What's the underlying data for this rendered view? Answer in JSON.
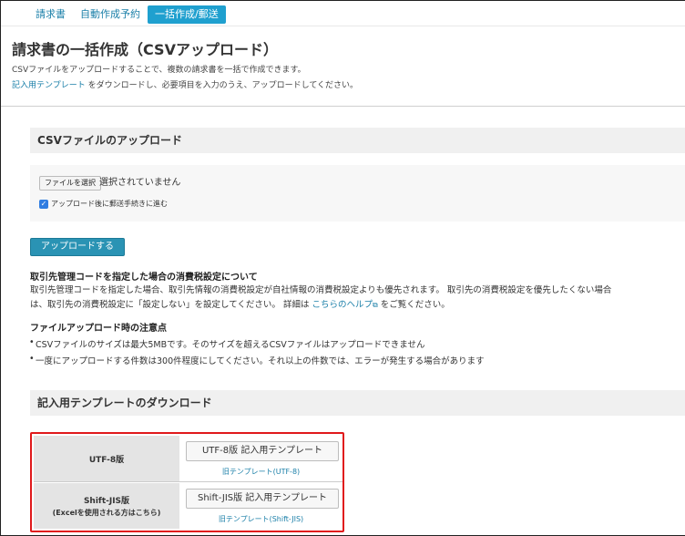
{
  "tabs": [
    {
      "label": "請求書",
      "active": false
    },
    {
      "label": "自動作成予約",
      "active": false
    },
    {
      "label": "一括作成/郵送",
      "active": true
    }
  ],
  "page_title": "請求書の一括作成（CSVアップロード）",
  "intro": {
    "line1": "CSVファイルをアップロードすることで、複数の請求書を一括で作成できます。",
    "template_link": "記入用テンプレート",
    "line2_rest": " をダウンロードし、必要項目を入力のうえ、アップロードしてください。"
  },
  "upload_section": {
    "title": "CSVファイルのアップロード",
    "file_button": "ファイルを選択",
    "file_status": "選択されていません",
    "checkbox_label": "アップロード後に郵送手続きに進む",
    "checkbox_checked": true,
    "upload_button": "アップロードする"
  },
  "tax_note": {
    "title": "取引先管理コードを指定した場合の消費税設定について",
    "line1": "取引先管理コードを指定した場合、取引先情報の消費税設定が自社情報の消費税設定よりも優先されます。 取引先の消費税設定を優先したくない場合",
    "line2_pre": "は、取引先の消費税設定に「設定しない」を設定してください。 詳細は ",
    "help_link": "こちらのヘルプ",
    "line2_post": " をご覧ください。"
  },
  "file_note": {
    "title": "ファイルアップロード時の注意点",
    "bullets": [
      "CSVファイルのサイズは最大5MBです。そのサイズを超えるCSVファイルはアップロードできません",
      "一度にアップロードする件数は300件程度にしてください。それ以上の件数では、エラーが発生する場合があります"
    ]
  },
  "template_section": {
    "title": "記入用テンプレートのダウンロード",
    "rows": [
      {
        "label": "UTF-8版",
        "sublabel": "",
        "button": "UTF-8版 記入用テンプレート",
        "link": "旧テンプレート(UTF-8)"
      },
      {
        "label": "Shift-JIS版",
        "sublabel": "(Excelを使用される方はこちら)",
        "button": "Shift-JIS版 記入用テンプレート",
        "link": "旧テンプレート(Shift-JIS)"
      }
    ]
  },
  "colors": {
    "accent": "#1fa0cf",
    "link": "#1a7fa8",
    "highlight_border": "#e0191b"
  }
}
